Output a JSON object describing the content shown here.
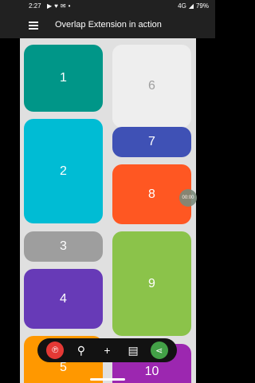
{
  "status": {
    "time": "2:27",
    "battery": "79%",
    "network": "4G"
  },
  "appbar": {
    "title": "Overlap Extension in action"
  },
  "tiles": [
    {
      "label": "1",
      "color": "#009688",
      "text_color": "#ffffff"
    },
    {
      "label": "6",
      "color": "#eeeeee",
      "text_color": "#9e9e9e"
    },
    {
      "label": "7",
      "color": "#3f51b5",
      "text_color": "#ffffff"
    },
    {
      "label": "2",
      "color": "#00bcd4",
      "text_color": "#ffffff"
    },
    {
      "label": "8",
      "color": "#ff5722",
      "text_color": "#ffffff"
    },
    {
      "label": "3",
      "color": "#9e9e9e",
      "text_color": "#ffffff"
    },
    {
      "label": "9",
      "color": "#8bc34a",
      "text_color": "#ffffff"
    },
    {
      "label": "4",
      "color": "#673ab7",
      "text_color": "#ffffff"
    },
    {
      "label": "5",
      "color": "#ff9800",
      "text_color": "#ffffff"
    },
    {
      "label": "10",
      "color": "#9c27b0",
      "text_color": "#ffffff"
    }
  ],
  "overlay_bubble": {
    "text": "00:00"
  },
  "toolbar": {
    "items": [
      {
        "icon": "pinterest-icon",
        "glyph": "℗",
        "bg": "#e53935"
      },
      {
        "icon": "search-icon",
        "glyph": "⚲",
        "bg": ""
      },
      {
        "icon": "add-icon",
        "glyph": "+",
        "bg": ""
      },
      {
        "icon": "chat-icon",
        "glyph": "▤",
        "bg": ""
      },
      {
        "icon": "share-icon",
        "glyph": "⋖",
        "bg": "#43a047"
      }
    ]
  }
}
